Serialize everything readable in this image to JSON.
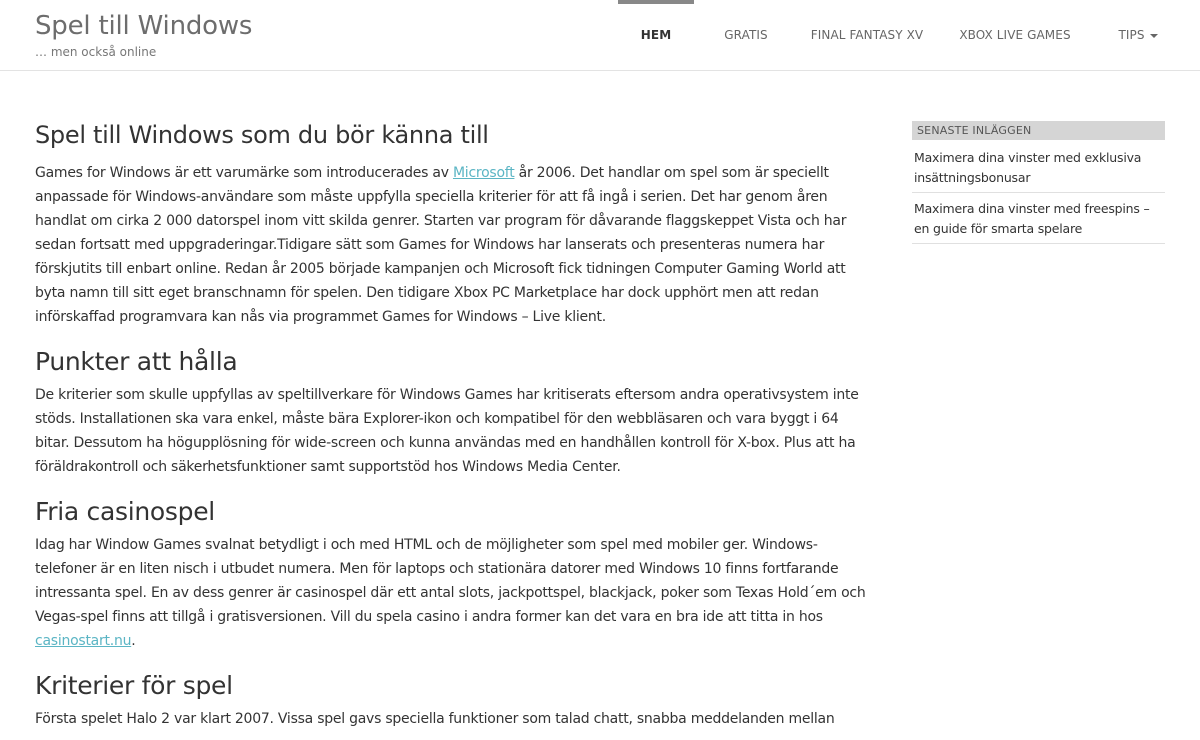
{
  "site": {
    "title": "Spel till Windows",
    "tagline": "… men också online"
  },
  "nav": {
    "items": [
      {
        "label": "HEM",
        "active": true
      },
      {
        "label": "GRATIS"
      },
      {
        "label": "FINAL FANTASY XV"
      },
      {
        "label": "XBOX LIVE GAMES"
      },
      {
        "label": "TIPS",
        "dropdown": true
      }
    ]
  },
  "article": {
    "title": "Spel till Windows som du bör känna till",
    "intro": {
      "before_link": "Games for Windows är ett varumärke som introducerades av ",
      "link": "Microsoft",
      "after_link": " år 2006. Det handlar om spel som är speciellt anpassade för Windows-användare som måste uppfylla speciella kriterier för att få ingå i serien. Det har genom åren handlat om cirka 2 000 datorspel inom vitt skilda genrer. Starten var program för dåvarande flaggskeppet Vista och har sedan fortsatt med uppgraderingar.Tidigare sätt som Games for Windows har lanserats och presenteras numera har förskjutits till enbart online. Redan år 2005 började kampanjen och Microsoft fick tidningen Computer Gaming World att byta namn till sitt eget branschnamn för spelen. Den tidigare Xbox PC Marketplace har dock upphört men att redan införskaffad programvara kan nås via programmet Games for Windows – Live klient."
    },
    "sections": [
      {
        "heading": "Punkter att hålla",
        "text": "De kriterier som skulle uppfyllas av speltillverkare för Windows Games har kritiserats eftersom andra operativsystem inte stöds. Installationen ska vara enkel, måste bära Explorer-ikon och kompatibel för den webbläsaren och vara byggt i 64 bitar. Dessutom ha högupplösning för wide-screen och kunna användas med en handhållen kontroll för X-box. Plus att ha föräldrakontroll och säkerhetsfunktioner samt supportstöd hos Windows Media Center."
      },
      {
        "heading": "Fria casinospel",
        "text_before_link": "Idag har Window Games svalnat betydligt i och med HTML och de möjligheter som spel med mobiler ger. Windows-telefoner är en liten nisch i utbudet numera. Men för laptops och stationära datorer med Windows 10 finns fortfarande intressanta spel. En av dess genrer är casinospel där ett antal slots, jackpottspel, blackjack, poker som Texas Hold´em och Vegas-spel finns att tillgå i gratisversionen. Vill du spela casino i andra former kan det vara en bra ide att titta in hos ",
        "link": "casinostart.nu",
        "text_after_link": "."
      },
      {
        "heading": "Kriterier för spel",
        "text": "Första spelet Halo 2 var klart 2007. Vissa spel gavs speciella funktioner som talad chatt, snabba meddelanden mellan"
      }
    ]
  },
  "sidebar": {
    "widget_title": "SENASTE INLÄGGEN",
    "posts": [
      "Maximera dina vinster med exklusiva insättningsbonusar",
      "Maximera dina vinster med freespins – en guide för smarta spelare"
    ]
  }
}
